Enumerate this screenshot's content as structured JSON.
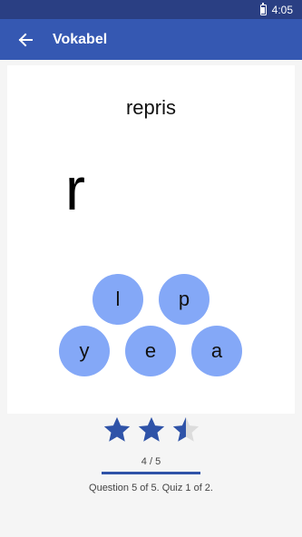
{
  "status_bar": {
    "time": "4:05"
  },
  "app_bar": {
    "title": "Vokabel"
  },
  "quiz": {
    "word": "repris",
    "answer_so_far": "r",
    "letters": [
      "l",
      "p",
      "y",
      "e",
      "a"
    ]
  },
  "rating": {
    "value": 2.5,
    "max": 3
  },
  "progress": {
    "label": "4 / 5",
    "fraction": 1.0
  },
  "summary": "Question 5 of 5. Quiz 1 of 2.",
  "colors": {
    "status_bar": "#2a3f83",
    "app_bar": "#3558b2",
    "letter_bubble": "#84a8f7",
    "star_filled": "#2f53a8",
    "star_empty": "#dcdcdc"
  }
}
